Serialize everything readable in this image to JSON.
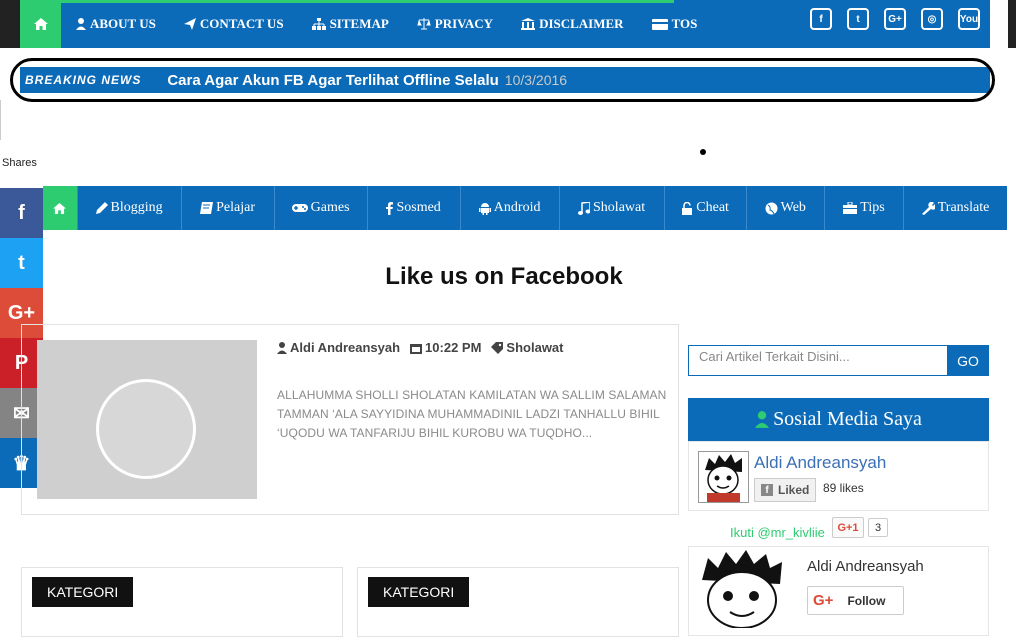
{
  "topnav": {
    "items": [
      {
        "label": "ABOUT US",
        "icon": "user-icon"
      },
      {
        "label": "CONTACT US",
        "icon": "paper-plane-icon"
      },
      {
        "label": "SITEMAP",
        "icon": "sitemap-icon"
      },
      {
        "label": "PRIVACY",
        "icon": "scale-icon"
      },
      {
        "label": "DISCLAIMER",
        "icon": "bank-icon"
      },
      {
        "label": "TOS",
        "icon": "card-icon"
      }
    ],
    "social": [
      {
        "name": "facebook-icon",
        "glyph": "f"
      },
      {
        "name": "twitter-icon",
        "glyph": "t"
      },
      {
        "name": "google-plus-icon",
        "glyph": "G+"
      },
      {
        "name": "instagram-icon",
        "glyph": "◎"
      },
      {
        "name": "youtube-icon",
        "glyph": "You"
      }
    ]
  },
  "breaking": {
    "label": "BREAKING NEWS",
    "headline": "Cara Agar Akun FB Agar Terlihat Offline Selalu",
    "date": "10/3/2016"
  },
  "shares_label": "Shares",
  "share_buttons": [
    {
      "name": "facebook-share-icon",
      "glyph": "f",
      "color": "#3b5998"
    },
    {
      "name": "twitter-share-icon",
      "glyph": "t",
      "color": "#1da1f2"
    },
    {
      "name": "google-plus-share-icon",
      "glyph": "G+",
      "color": "#dd4b39"
    },
    {
      "name": "pinterest-share-icon",
      "glyph": "P",
      "color": "#cb2027"
    },
    {
      "name": "email-share-icon",
      "glyph": "✉",
      "color": "#848484"
    },
    {
      "name": "sumo-share-icon",
      "glyph": "♛",
      "color": "#0b6bb8"
    }
  ],
  "catnav": {
    "items": [
      {
        "label": "Blogging",
        "icon": "pencil-icon",
        "w": 104
      },
      {
        "label": "Pelajar",
        "icon": "book-icon",
        "w": 93
      },
      {
        "label": "Games",
        "icon": "gamepad-icon",
        "w": 93
      },
      {
        "label": "Sosmed",
        "icon": "facebook-icon",
        "w": 93
      },
      {
        "label": "Android",
        "icon": "android-icon",
        "w": 99
      },
      {
        "label": "Sholawat",
        "icon": "music-icon",
        "w": 105
      },
      {
        "label": "Cheat",
        "icon": "unlock-icon",
        "w": 82
      },
      {
        "label": "Web",
        "icon": "globe-icon",
        "w": 78
      },
      {
        "label": "Tips",
        "icon": "briefcase-icon",
        "w": 79
      },
      {
        "label": "Translate",
        "icon": "wrench-icon",
        "w": 104
      }
    ]
  },
  "like_title": "Like us on Facebook",
  "post": {
    "author": "Aldi Andreansyah",
    "time": "10:22 PM",
    "category": "Sholawat",
    "excerpt": "ALLAHUMMA SHOLLI SHOLATAN KAMILATAN WA SALLIM SALAMAN TAMMAN ‘ALA SAYYIDINA MUHAMMADINIL LADZI TANHALLU BIHIL ‘UQODU WA TANFARIJU BIHIL KUROBU WA TUQDHO..."
  },
  "kategori": [
    "KATEGORI",
    "KATEGORI"
  ],
  "search": {
    "placeholder": "Cari Artikel Terkait Disini...",
    "button": "GO"
  },
  "widget": {
    "title": "Sosial Media Saya"
  },
  "fb_page": {
    "name": "Aldi Andreansyah",
    "liked_label": "Liked",
    "likes": "89 likes"
  },
  "gplus": {
    "ikuti": "Ikuti @mr_kivliie",
    "btn": "G+1",
    "count": "3",
    "name": "Aldi Andreansyah",
    "follow": "Follow"
  },
  "colors": {
    "brand_blue": "#0b6bb8",
    "accent_green": "#2ecc71"
  }
}
